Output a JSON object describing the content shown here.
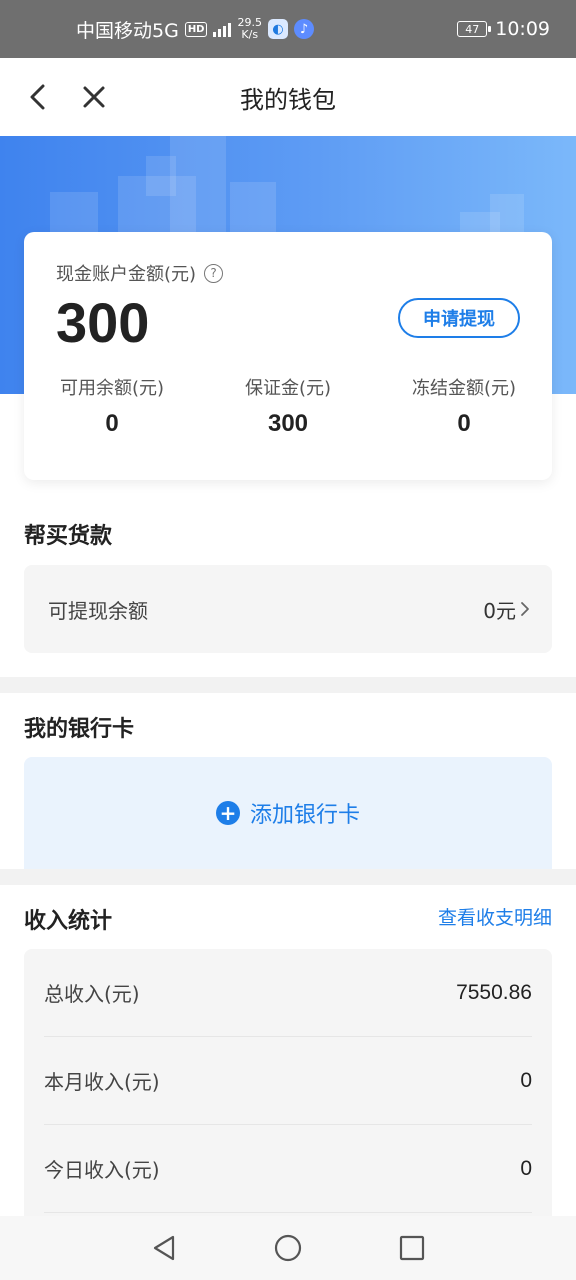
{
  "status_bar": {
    "carrier": "中国移动5G",
    "hd": "HD",
    "net_speed_value": "29.5",
    "net_speed_unit": "K/s",
    "battery": "47",
    "time": "10:09"
  },
  "header": {
    "title": "我的钱包"
  },
  "balance_card": {
    "label": "现金账户金额(元)",
    "amount": "300",
    "withdraw_label": "申请提现",
    "stats": [
      {
        "label": "可用余额(元)",
        "value": "0"
      },
      {
        "label": "保证金(元)",
        "value": "300"
      },
      {
        "label": "冻结金额(元)",
        "value": "0"
      }
    ]
  },
  "purchase_section": {
    "title": "帮买货款",
    "row_label": "可提现余额",
    "row_value": "0元"
  },
  "bank_section": {
    "title": "我的银行卡",
    "add_label": "添加银行卡"
  },
  "income_section": {
    "title": "收入统计",
    "detail_link": "查看收支明细",
    "rows": [
      {
        "label": "总收入(元)",
        "value": "7550.86"
      },
      {
        "label": "本月收入(元)",
        "value": "0"
      },
      {
        "label": "今日收入(元)",
        "value": "0"
      }
    ]
  },
  "colors": {
    "accent": "#1e7ee8",
    "banner_start": "#3f83ee",
    "banner_end": "#7bb8fa",
    "status_bar": "#6f6f6f"
  }
}
